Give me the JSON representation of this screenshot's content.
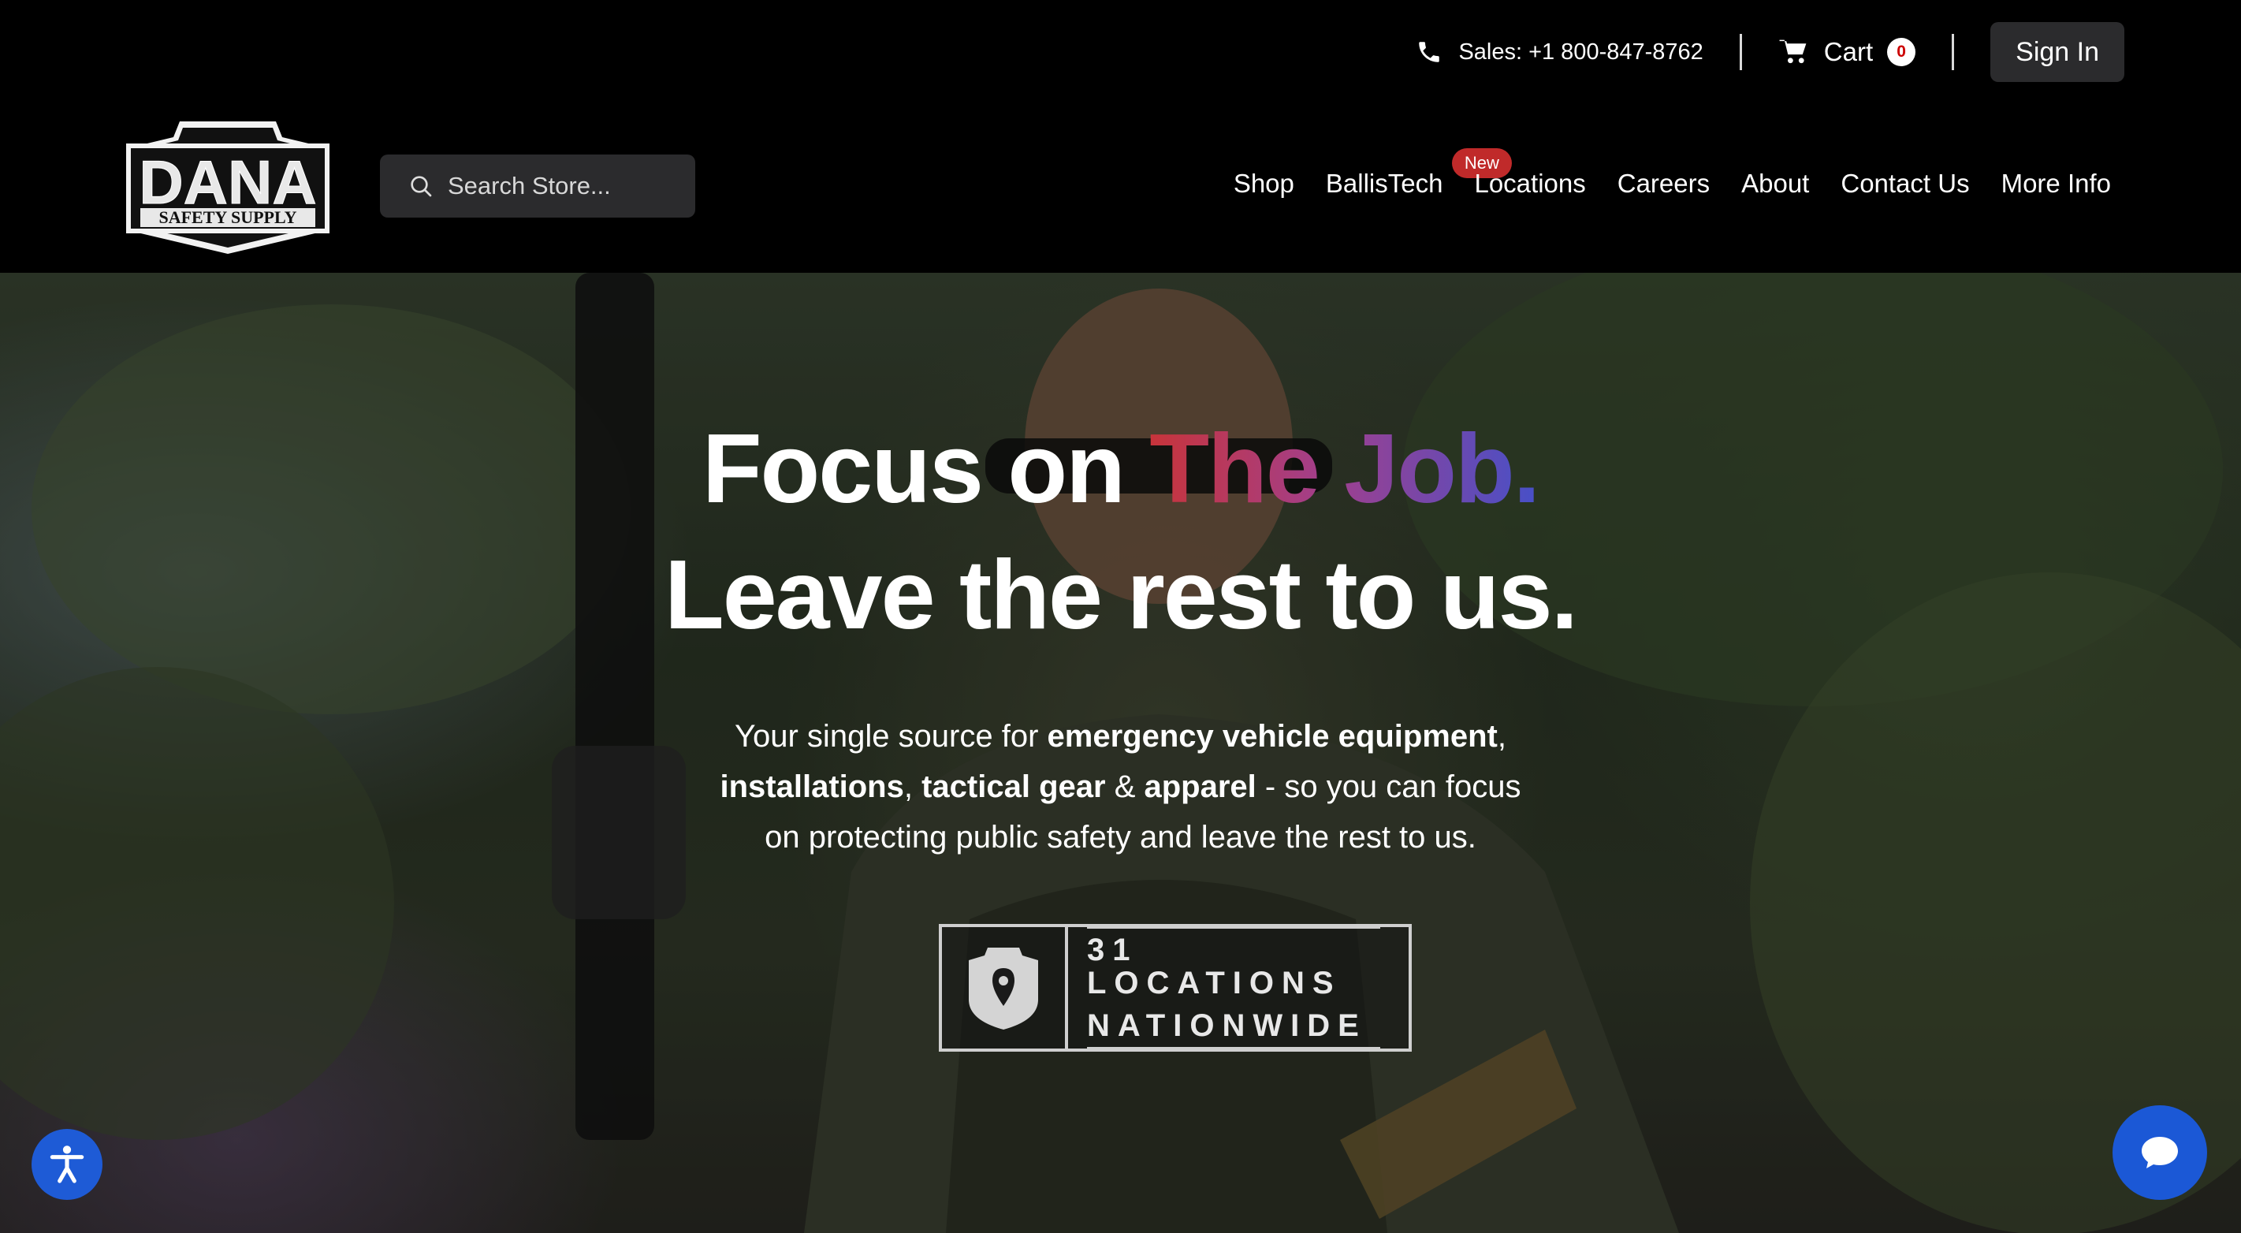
{
  "header": {
    "phone": {
      "label": "Sales:",
      "number": "+1 800-847-8762",
      "icon": "phone-icon"
    },
    "cart": {
      "label": "Cart",
      "count": "0",
      "icon": "cart-icon"
    },
    "signin_label": "Sign In",
    "logo": {
      "text": "DANA",
      "subtext": "SAFETY SUPPLY"
    },
    "search": {
      "placeholder": "Search Store...",
      "value": "",
      "icon": "search-icon"
    },
    "nav": [
      {
        "label": "Shop"
      },
      {
        "label": "BallisTech",
        "badge": "New"
      },
      {
        "label": "Locations"
      },
      {
        "label": "Careers"
      },
      {
        "label": "About"
      },
      {
        "label": "Contact Us"
      },
      {
        "label": "More Info"
      }
    ]
  },
  "hero": {
    "headline_1_plain": "Focus on ",
    "headline_1_accent": "The Job.",
    "headline_2": "Leave the rest to us.",
    "sub": {
      "p1": "Your single source for ",
      "b1": "emergency vehicle equipment",
      "p2": ", ",
      "b2": "installations",
      "p3": ", ",
      "b3": "tactical gear",
      "p4": " & ",
      "b4": "apparel",
      "p5": " - so you can focus on protecting public safety and leave the rest to us."
    },
    "locations_badge": {
      "line1": "31 LOCATIONS",
      "line2": "NATIONWIDE",
      "icon": "location-shield-icon"
    }
  },
  "widgets": {
    "accessibility_icon": "accessibility-icon",
    "chat_icon": "chat-icon"
  },
  "colors": {
    "header_bg": "#000000",
    "button_bg": "#2b2b2d",
    "new_badge": "#c02a2a",
    "accent_gradient_start": "#c8343a",
    "accent_gradient_end": "#4750c8",
    "widget_blue": "#1e5bd6"
  }
}
